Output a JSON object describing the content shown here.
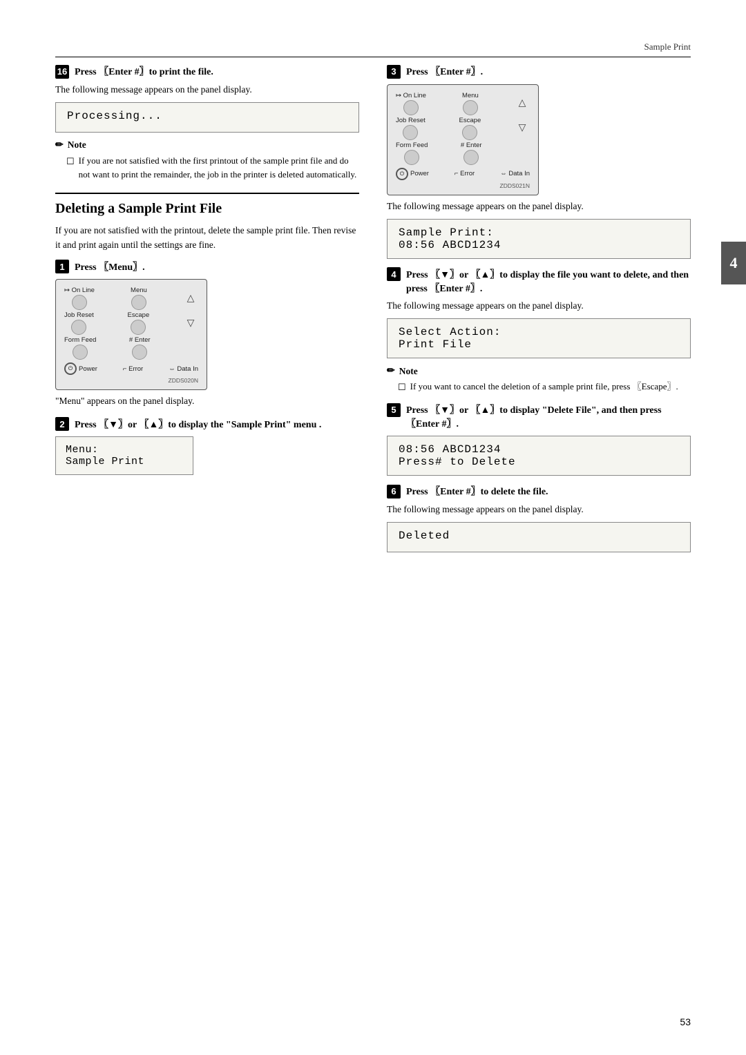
{
  "header": {
    "title": "Sample Print"
  },
  "page_number": "53",
  "tab_marker": "4",
  "section16": {
    "step_num": "16",
    "step_label": "Press 〖Enter #〗to print the file.",
    "body1": "The following message appears on the panel display.",
    "lcd1": "Processing...",
    "note_header": "Note",
    "note_item": "If you are not satisfied with the first printout of the sample print file and do not want to print the remainder, the job in the printer is deleted automatically."
  },
  "deleting_section": {
    "title": "Deleting a Sample Print File",
    "body": "If you are not satisfied with the printout, delete the sample print file. Then revise it and print again until the settings are fine."
  },
  "step1": {
    "num": "1",
    "label": "Press 〖Menu〗.",
    "panel_code": "ZDDS020N",
    "body": "\"Menu\" appears on the panel display."
  },
  "step2": {
    "num": "2",
    "label": "Press 〖▼〗or 〖▲〗to display the \"Sample Print\" menu .",
    "menu_lcd_line1": "Menu:",
    "menu_lcd_line2": "Sample Print"
  },
  "step3": {
    "num": "3",
    "label": "Press 〖Enter #〗.",
    "panel_code": "ZDDS021N",
    "body": "The following message appears on the panel display.",
    "lcd": "Sample Print:\n08:56 ABCD1234"
  },
  "step4": {
    "num": "4",
    "label": "Press 〖▼〗or 〖▲〗to display the file you want to delete, and then press 〖Enter #〗.",
    "body": "The following message appears on the panel display.",
    "lcd": "Select Action:\nPrint File",
    "note_header": "Note",
    "note_item": "If you want to cancel the deletion of a sample print file, press 〖Escape〗."
  },
  "step5": {
    "num": "5",
    "label": "Press 〖▼〗or 〖▲〗to display \"Delete File\", and then press 〖Enter #〗.",
    "lcd": "08:56  ABCD1234\nPress# to Delete"
  },
  "step6": {
    "num": "6",
    "label": "Press 〖Enter #〗to delete the file.",
    "body": "The following message appears on the panel display.",
    "lcd": "Deleted"
  },
  "panel": {
    "on_line": "On Line",
    "menu": "Menu",
    "job_reset": "Job Reset",
    "escape": "Escape",
    "form_feed": "Form Feed",
    "enter": "# Enter",
    "power": "Power",
    "error": "Error",
    "data_in": "Data In"
  }
}
